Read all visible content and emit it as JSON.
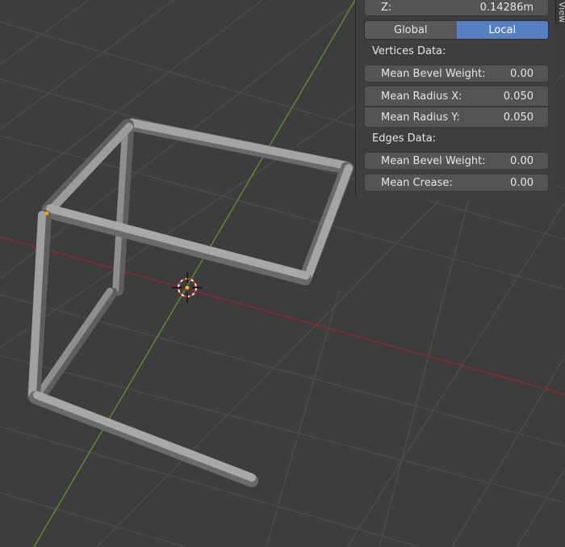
{
  "viewport": {
    "colors": {
      "background": "#3d3d3d",
      "grid": "#4a4a4a",
      "x_axis": "#8c2a34",
      "y_axis": "#5a8a2a",
      "mesh": "#9a9a9a",
      "mesh_shadow": "#6a6a6a"
    }
  },
  "npanel": {
    "tab_label": "View",
    "z_label": "Z:",
    "z_value": "0.14286m",
    "global_label": "Global",
    "local_label": "Local",
    "vertices_header": "Vertices Data:",
    "vertices": {
      "bevel_label": "Mean Bevel Weight:",
      "bevel_value": "0.00",
      "radius_x_label": "Mean Radius X:",
      "radius_x_value": "0.050",
      "radius_y_label": "Mean Radius Y:",
      "radius_y_value": "0.050"
    },
    "edges_header": "Edges Data:",
    "edges": {
      "bevel_label": "Mean Bevel Weight:",
      "bevel_value": "0.00",
      "crease_label": "Mean Crease:",
      "crease_value": "0.00"
    },
    "colors": {
      "panel_bg": "#3e3e3e",
      "field_bg": "#545454",
      "active_toggle": "#5680c2"
    }
  }
}
